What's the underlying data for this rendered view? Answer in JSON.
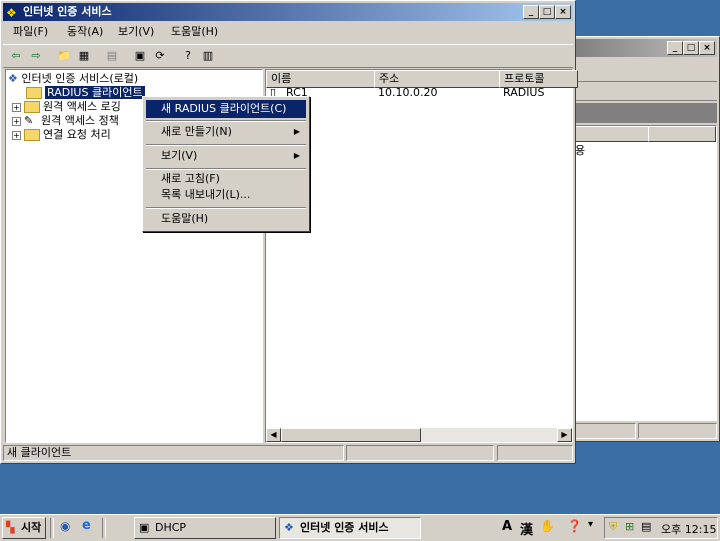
{
  "main_window": {
    "title": "인터넷 인증 서비스",
    "menus": [
      "파일(F)",
      "동작(A)",
      "보기(V)",
      "도움말(H)"
    ],
    "status": "새 클라이언트"
  },
  "tree": {
    "root": "인터넷 인증 서비스(로컬)",
    "items": [
      "RADIUS 클라이언트",
      "원격 액세스 로깅",
      "원격 액세스 정책",
      "연결 요청 처리"
    ]
  },
  "list": {
    "columns": [
      "이름",
      "주소",
      "프로토콜"
    ],
    "rows": [
      {
        "name": "RC1",
        "address": "10.10.0.20",
        "protocol": "RADIUS"
      }
    ]
  },
  "context_menu": {
    "items": [
      "새 RADIUS 클라이언트(C)",
      "새로 만들기(N)",
      "보기(V)",
      "새로 고침(F)",
      "목록 내보내기(L)...",
      "도움말(H)"
    ]
  },
  "bg_window": {
    "text_fragment": "용"
  },
  "taskbar": {
    "start": "시작",
    "tasks": [
      "DHCP",
      "인터넷 인증 서비스"
    ],
    "ime_a": "A",
    "ime_han": "漢",
    "clock": "오후 12:15"
  },
  "colors": {
    "desktop": "#3a6ea5",
    "face": "#d4d0c8",
    "title_active": "#0a246a",
    "selection": "#0a246a"
  }
}
